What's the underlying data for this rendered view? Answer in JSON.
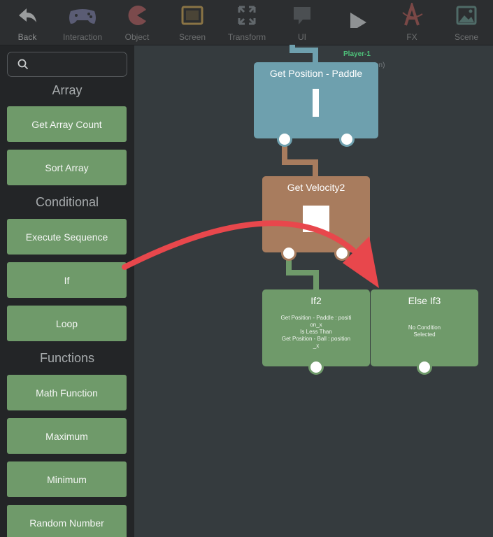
{
  "toolbar": {
    "items": [
      {
        "label": "Back",
        "icon": "back-arrow-icon"
      },
      {
        "label": "Interaction",
        "icon": "gamepad-icon"
      },
      {
        "label": "Object",
        "icon": "pacman-icon"
      },
      {
        "label": "Screen",
        "icon": "tablet-icon"
      },
      {
        "label": "Transform",
        "icon": "expand-icon"
      },
      {
        "label": "UI",
        "icon": "chat-bubble-icon"
      },
      {
        "label": "",
        "icon": "play-icon"
      },
      {
        "label": "FX",
        "icon": "fx-icon"
      },
      {
        "label": "Scene",
        "icon": "image-icon"
      }
    ]
  },
  "sidebar": {
    "search_placeholder": "",
    "sections": [
      {
        "title": "Array",
        "items": [
          "Get Array Count",
          "Sort Array"
        ]
      },
      {
        "title": "Conditional",
        "items": [
          "Execute Sequence",
          "If",
          "Loop"
        ]
      },
      {
        "title": "Functions",
        "items": [
          "Math Function",
          "Maximum",
          "Minimum",
          "Random Number"
        ]
      }
    ]
  },
  "canvas": {
    "object_label": "Player-1",
    "object_hint": "on)",
    "blocks": {
      "get_position": {
        "title": "Get Position - Paddle"
      },
      "get_velocity": {
        "title": "Get Velocity2"
      },
      "if2": {
        "title": "If2",
        "condition": [
          "Get Position - Paddle : positi",
          "on_x",
          "Is Less Than",
          "Get Position - Ball : position",
          "_x"
        ]
      },
      "else_if3": {
        "title": "Else If3",
        "condition": [
          "No Condition",
          "Selected"
        ]
      }
    }
  },
  "colors": {
    "green_block": "#6f9a6a",
    "blue_block": "#6ea0ae",
    "brown_block": "#a87c5e",
    "arrow": "#e8474c",
    "object_label": "#4ec27a"
  }
}
